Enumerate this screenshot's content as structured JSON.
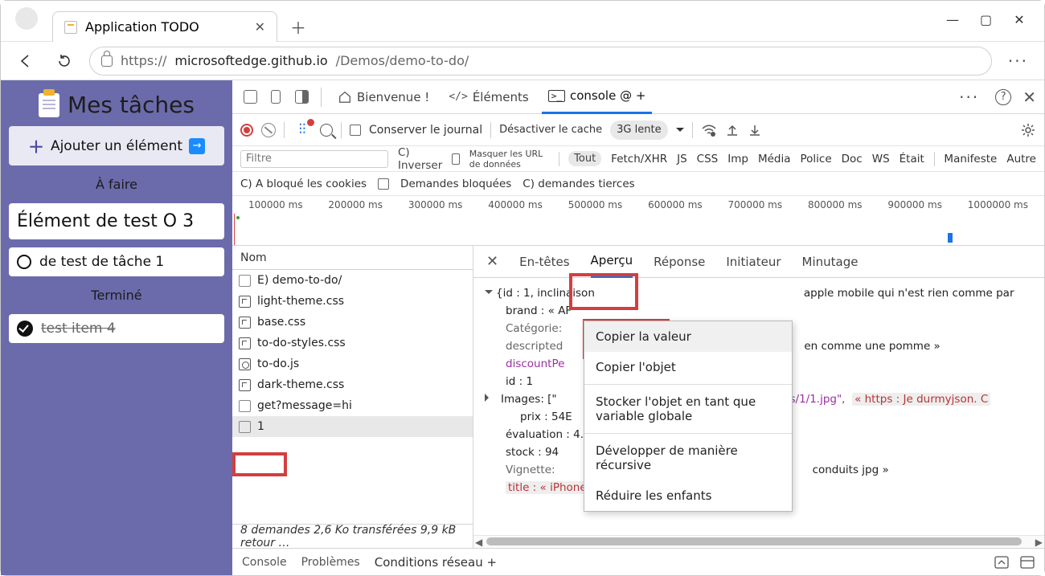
{
  "browser": {
    "tab_title": "Application TODO",
    "url_prefix": "https://",
    "url_host": "microsoftedge.github.io",
    "url_path": "/Demos/demo-to-do/"
  },
  "page": {
    "title": "Mes tâches",
    "add_label": "Ajouter un élément",
    "section_todo": "À faire",
    "section_done": "Terminé",
    "big_task": "Élément de test O 3",
    "pending_task": "de test de tâche 1",
    "done_task": "test item 4"
  },
  "devtools": {
    "tabs": {
      "welcome": "Bienvenue !",
      "elements": "Éléments",
      "console_quick": "console @ +"
    },
    "toolbar": {
      "preserve_log": "Conserver le journal",
      "disable_cache": "Désactiver le cache",
      "throttle": "3G lente"
    },
    "filter": {
      "placeholder": "Filtre",
      "invert": "C) Inverser",
      "hide_data": "Masquer les URL de données",
      "types": [
        "Tout",
        "Fetch/XHR",
        "JS",
        "CSS",
        "Imp",
        "Média",
        "Police",
        "Doc",
        "WS",
        "Était",
        "Manifeste",
        "Autre"
      ]
    },
    "options": {
      "blocked_cookies": "C) A bloqué les cookies",
      "blocked_reqs": "Demandes bloquées",
      "third_party": "C) demandes tierces"
    },
    "timeline_ticks": [
      "100000 ms",
      "200000 ms",
      "300000 ms",
      "400000 ms",
      "500000 ms",
      "600000 ms",
      "700000 ms",
      "800000 ms",
      "900000 ms",
      "1000000 ms"
    ],
    "reqlist_header": "Nom",
    "requests": [
      {
        "name": "E) demo-to-do/",
        "type": "doc"
      },
      {
        "name": "light-theme.css",
        "type": "css"
      },
      {
        "name": "base.css",
        "type": "css"
      },
      {
        "name": "to-do-styles.css",
        "type": "css"
      },
      {
        "name": "to-do.js",
        "type": "js"
      },
      {
        "name": "dark-theme.css",
        "type": "css"
      },
      {
        "name": "get?message=hi",
        "type": "doc"
      },
      {
        "name": "1",
        "type": "doc",
        "selected": true
      }
    ],
    "detail_tabs": [
      "En-têtes",
      "Aperçu",
      "Réponse",
      "Initiateur",
      "Minutage"
    ],
    "preview": {
      "l0": "{id : 1, inclinaison",
      "l0b": "apple mobile qui n'est rien comme par",
      "brand_k": "brand : « AF",
      "cat": "Catégorie:",
      "desc": "descripted",
      "desc_tail": "en comme une pomme »",
      "disc": "discountPe",
      "id": "id : 1",
      "images": "Images:   [\"",
      "images_mid": "ducts/1/1.jpg\",",
      "images_tail": "« https : Je durmyjson. C",
      "price": "prix : 54E",
      "rating": "évaluation : 4.",
      "stock": "stock : 94",
      "thumb": "Vignette:",
      "thumb_tail": "conduits jpg »",
      "title": "title : « iPhone 9 »"
    },
    "context_menu": [
      "Copier la valeur",
      "Copier l'objet",
      "Stocker l'objet en tant que variable globale",
      "Développer de manière récursive",
      "Réduire les enfants"
    ],
    "status": "8 demandes 2,6 Ko transférées 9,9 kB retour …",
    "drawer": {
      "console": "Console",
      "problems": "Problèmes",
      "netcond": "Conditions réseau +"
    }
  }
}
